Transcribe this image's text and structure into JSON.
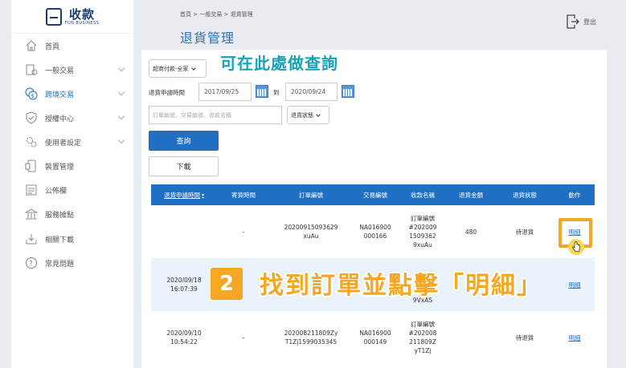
{
  "brand": {
    "name": "收款",
    "sub": "FUN BUSINESS"
  },
  "sidebar": {
    "items": [
      {
        "label": "首頁",
        "icon": "home-icon",
        "expandable": false,
        "active": false
      },
      {
        "label": "一般交易",
        "icon": "coins-icon",
        "expandable": true,
        "active": false
      },
      {
        "label": "跨境交易",
        "icon": "currency-exchange-icon",
        "expandable": true,
        "active": true
      },
      {
        "label": "授權中心",
        "icon": "shield-icon",
        "expandable": true,
        "active": false
      },
      {
        "label": "使用者設定",
        "icon": "gears-icon",
        "expandable": true,
        "active": false
      },
      {
        "label": "裝置管理",
        "icon": "device-icon",
        "expandable": false,
        "active": false
      },
      {
        "label": "公佈欄",
        "icon": "bulletin-icon",
        "expandable": false,
        "active": false
      },
      {
        "label": "服務據點",
        "icon": "bank-icon",
        "expandable": false,
        "active": false
      },
      {
        "label": "相關下載",
        "icon": "download-icon",
        "expandable": false,
        "active": false
      },
      {
        "label": "常見問題",
        "icon": "question-icon",
        "expandable": false,
        "active": false
      }
    ]
  },
  "header": {
    "breadcrumb": "首頁 > 一般交易 > 退貨管理",
    "title": "退貨管理",
    "logout_label": "登出"
  },
  "filters": {
    "payment_type": "超商付款-全家",
    "date_label": "退貨申請時間",
    "date_from": "2017/09/25",
    "date_to_label": "到",
    "date_to": "2020/09/24",
    "search_placeholder": "訂單編號、交易編號、收款名稱",
    "status_select": "退貨狀態",
    "query_button": "查詢",
    "download_button": "下載"
  },
  "hint": "可在此處做查詢",
  "table": {
    "headers": [
      "退貨申請時間",
      "寄貨時間",
      "訂單編號",
      "交易編號",
      "收款名稱",
      "退貨金額",
      "退貨狀態",
      "動作"
    ],
    "rows": [
      {
        "apply_time": "",
        "ship_time": "-",
        "order_no": "20200915093629\nxuAu",
        "txn_no": "NA016900\n000166",
        "name": "訂單編號\n#202009\n1509362\n9xuAu",
        "amount": "480",
        "status": "待退貨",
        "action": "明細"
      },
      {
        "apply_time": "2020/09/18\n16:07:39",
        "ship_time": "",
        "order_no": "",
        "txn_no": "",
        "name": "9VxAS",
        "amount": "",
        "status": "",
        "action": "明細"
      },
      {
        "apply_time": "2020/09/10\n10:54:22",
        "ship_time": "-",
        "order_no": "202008211809Zy\nT1Zj1599035345",
        "txn_no": "NA016900\n000149",
        "name": "訂單編號\n#202008\n211809Z\nyT1Zj",
        "amount": "",
        "status": "待退貨",
        "action": "明細"
      }
    ]
  },
  "annotation": {
    "step": "2",
    "text": "找到訂單並點擊「明細」"
  },
  "colors": {
    "primary": "#1f6fc5",
    "accent": "#f5a623",
    "hint": "#17a2b8"
  }
}
